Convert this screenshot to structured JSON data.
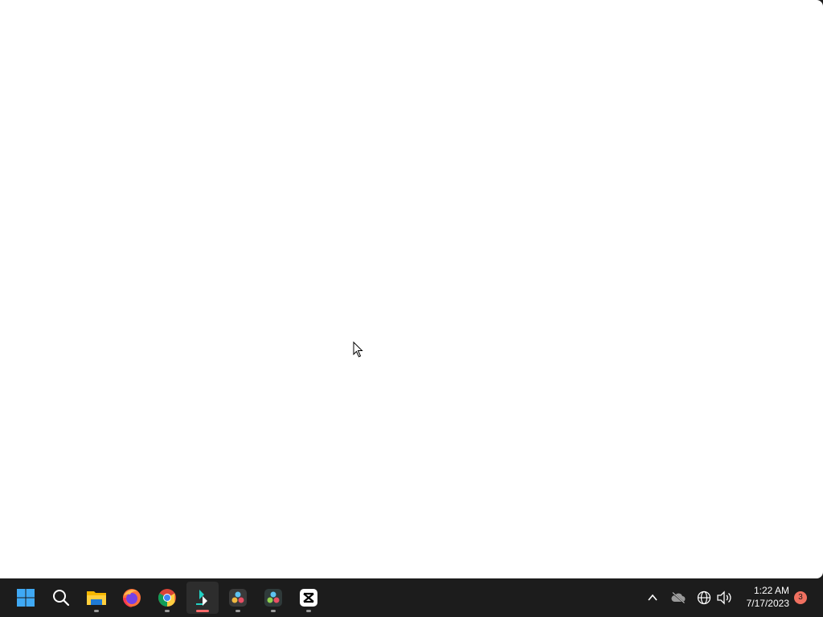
{
  "window": {
    "content": ""
  },
  "taskbar": {
    "apps": [
      {
        "name": "Start",
        "icon": "windows-logo-icon",
        "running": false,
        "active": false
      },
      {
        "name": "Search",
        "icon": "search-icon",
        "running": false,
        "active": false
      },
      {
        "name": "File Explorer",
        "icon": "folder-icon",
        "running": true,
        "active": false
      },
      {
        "name": "Firefox",
        "icon": "firefox-icon",
        "running": false,
        "active": false
      },
      {
        "name": "Google Chrome",
        "icon": "chrome-icon",
        "running": true,
        "active": false
      },
      {
        "name": "Filmora",
        "icon": "filmora-icon",
        "running": true,
        "active": true
      },
      {
        "name": "DaVinci Resolve",
        "icon": "davinci-resolve-icon",
        "running": true,
        "active": false
      },
      {
        "name": "DaVinci Resolve",
        "icon": "davinci-resolve-icon",
        "running": true,
        "active": false
      },
      {
        "name": "CapCut",
        "icon": "capcut-icon",
        "running": true,
        "active": false
      }
    ],
    "tray": {
      "chevron_icon": "chevron-up-icon",
      "onedrive_icon": "cloud-offline-icon",
      "network_icon": "globe-icon",
      "volume_icon": "speaker-icon"
    },
    "clock": {
      "time": "1:22 AM",
      "date": "7/17/2023"
    },
    "notifications": {
      "count": "3"
    }
  },
  "colors": {
    "taskbar_bg": "#1c1c1c",
    "window_bg": "#ffffff",
    "active_indicator": "#ff6a6a",
    "badge": "#f07060"
  }
}
